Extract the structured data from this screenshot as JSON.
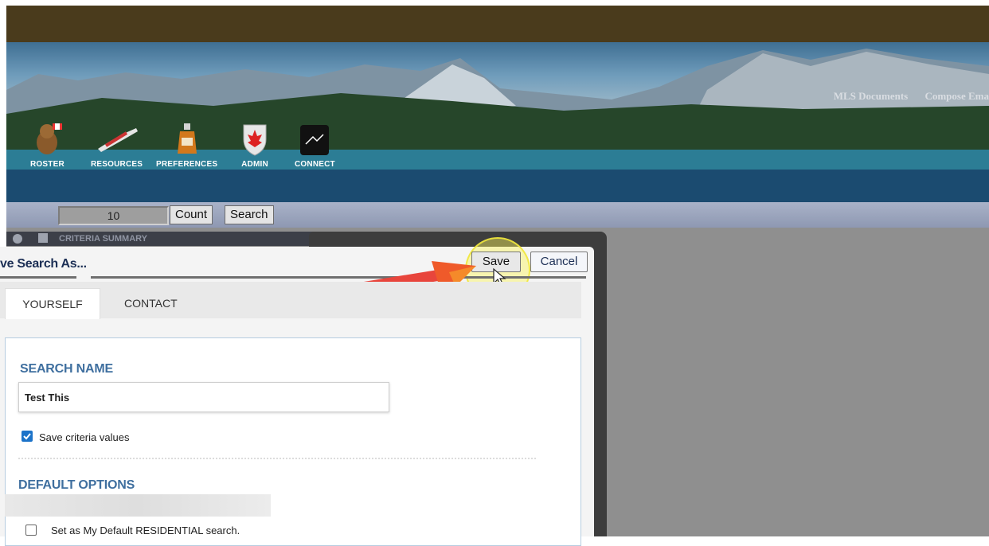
{
  "header": {
    "links": [
      "MLS Documents",
      "Compose Ema"
    ],
    "nav": [
      {
        "label": "ROSTER",
        "icon": "beaver-icon"
      },
      {
        "label": "RESOURCES",
        "icon": "canoe-icon"
      },
      {
        "label": "PREFERENCES",
        "icon": "maple-syrup-icon"
      },
      {
        "label": "ADMIN",
        "icon": "maple-leaf-shield-icon"
      },
      {
        "label": "CONNECT",
        "icon": "connect-mountain-icon"
      }
    ]
  },
  "searchbar": {
    "count_value": "10",
    "count_label": "Count",
    "search_label": "Search"
  },
  "criteria": {
    "label": "CRITERIA SUMMARY"
  },
  "dialog": {
    "title": "ve Search As...",
    "save_label": "Save",
    "cancel_label": "Cancel",
    "tabs": [
      "YOURSELF",
      "CONTACT"
    ],
    "search_name_heading": "SEARCH NAME",
    "search_name_value": "Test This",
    "save_criteria_label": "Save criteria values",
    "save_criteria_checked": true,
    "default_options_heading": "DEFAULT OPTIONS",
    "default_residential_label": "Set as My Default RESIDENTIAL search.",
    "default_residential_checked": false
  },
  "colors": {
    "accent_blue": "#3f6f9f",
    "title_navy": "#1c2f55",
    "checkbox_blue": "#1c73c9",
    "arrow_red": "#e8453c",
    "highlight_yellow": "#f5ee5a"
  }
}
